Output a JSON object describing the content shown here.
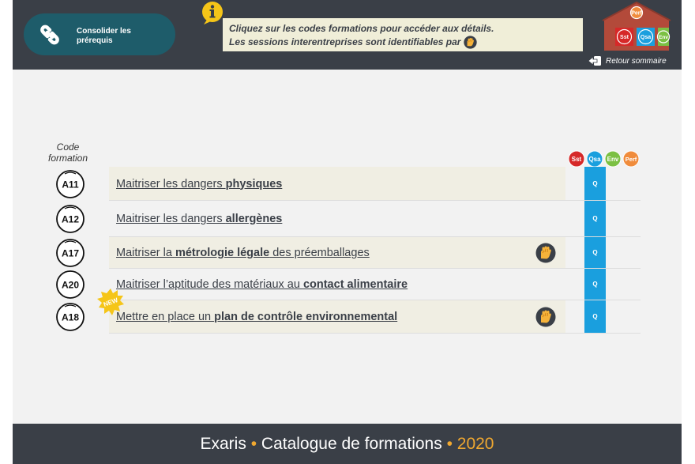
{
  "header": {
    "prereq_label_line1": "Consolider les",
    "prereq_label_line2": "prérequis",
    "info_line1": "Cliquez sur les codes formations pour accéder aux détails.",
    "info_line2": "Les sessions interentreprises sont identifiables par",
    "retour_label": "Retour sommaire",
    "house": {
      "roof": "Perf",
      "left": "Sst",
      "mid": "Qsa",
      "right": "Env"
    }
  },
  "table": {
    "code_header_line1": "Code",
    "code_header_line2": "formation",
    "categories": [
      "Sst",
      "Qsa",
      "Env",
      "Perf"
    ],
    "category_colors": {
      "Sst": "#d62828",
      "Qsa": "#1a9fde",
      "Env": "#7bc043",
      "Perf": "#f08c3c"
    },
    "rows": [
      {
        "code": "A11",
        "title_pre": "Maitriser les dangers ",
        "title_bold": "physiques",
        "title_post": "",
        "q": "Q",
        "interentreprise": false,
        "is_new": false
      },
      {
        "code": "A12",
        "title_pre": "Maitriser les dangers ",
        "title_bold": "allergènes",
        "title_post": "",
        "q": "Q",
        "interentreprise": false,
        "is_new": false
      },
      {
        "code": "A17",
        "title_pre": "Maitriser la ",
        "title_bold": "métrologie légale",
        "title_post": " des préemballages",
        "q": "Q",
        "interentreprise": true,
        "is_new": false
      },
      {
        "code": "A20",
        "title_pre": "Maitriser l’aptitude des matériaux au ",
        "title_bold": "contact alimentaire",
        "title_post": "",
        "q": "Q",
        "interentreprise": false,
        "is_new": false
      },
      {
        "code": "A18",
        "title_pre": "Mettre en place un ",
        "title_bold": "plan de contrôle environnemental",
        "title_post": "",
        "q": "Q",
        "interentreprise": true,
        "is_new": true,
        "new_label": "NEW"
      }
    ]
  },
  "footer": {
    "brand": "Exaris",
    "separator": "•",
    "title": "Catalogue de formations",
    "year": "2020"
  },
  "colors": {
    "header_bg": "#3a3f47",
    "prereq_bg": "#1e5c6a",
    "accent_orange": "#f0a830",
    "q_blue": "#1a9fde",
    "info_yellow": "#f5c518"
  }
}
